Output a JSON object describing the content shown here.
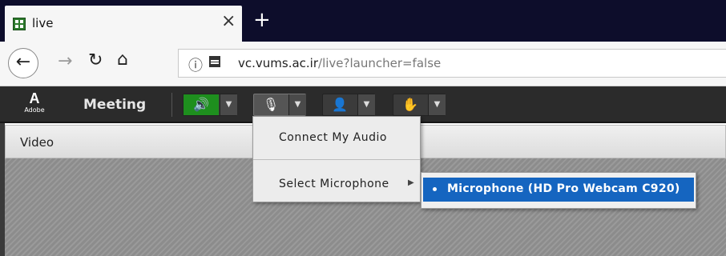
{
  "browser": {
    "tab_title": "live",
    "close_glyph": "×",
    "newtab_glyph": "+",
    "url_host": "vc.vums.ac.ir",
    "url_path": "/live?launcher=false",
    "icons": [
      "favicon-icon",
      "back-icon",
      "forward-icon",
      "reload-icon",
      "home-icon",
      "info-icon",
      "page-icon"
    ]
  },
  "toolbar": {
    "logo_mark": "A",
    "logo_word": "Adobe",
    "meeting_label": "Meeting",
    "buttons": [
      {
        "name": "speaker-icon",
        "state": "active"
      },
      {
        "name": "microphone-icon",
        "state": "menu-open"
      },
      {
        "name": "camera-icon",
        "state": "off"
      },
      {
        "name": "raise-hand-icon",
        "state": "off"
      }
    ]
  },
  "pod": {
    "title": "Video"
  },
  "audio_menu": {
    "connect_label": "Connect My Audio",
    "select_mic_label": "Select Microphone",
    "submenu_items": [
      {
        "label": "Microphone (HD Pro Webcam C920)",
        "selected": true
      }
    ]
  },
  "colors": {
    "tabbar_bg": "#0d0d2b",
    "appbar_bg": "#2b2b2b",
    "speaker_active": "#1e8f1e",
    "submenu_highlight": "#1565c0"
  }
}
